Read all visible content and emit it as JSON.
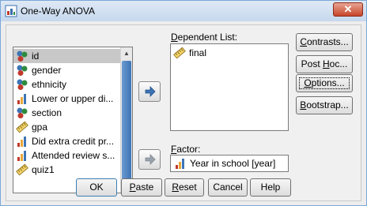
{
  "window": {
    "title": "One-Way ANOVA",
    "close_label": "✕"
  },
  "variables": [
    {
      "label": "id",
      "icon": "nominal-icon",
      "selected": true
    },
    {
      "label": "gender",
      "icon": "nominal-icon"
    },
    {
      "label": "ethnicity",
      "icon": "nominal-icon"
    },
    {
      "label": "Lower or upper di...",
      "icon": "ordinal-icon"
    },
    {
      "label": "section",
      "icon": "nominal-icon"
    },
    {
      "label": "gpa",
      "icon": "scale-icon"
    },
    {
      "label": "Did extra credit pr...",
      "icon": "ordinal-icon"
    },
    {
      "label": "Attended review s...",
      "icon": "ordinal-icon"
    },
    {
      "label": "quiz1",
      "icon": "scale-icon"
    }
  ],
  "dependent": {
    "label_prefix": "",
    "label_u": "D",
    "label_rest": "ependent List:",
    "items": [
      {
        "label": "final",
        "icon": "scale-icon"
      }
    ]
  },
  "factor": {
    "label_u": "F",
    "label_rest": "actor:",
    "value": "Year in school [year]",
    "icon": "ordinal-icon"
  },
  "side_buttons": [
    {
      "name": "contrasts-button",
      "u": "C",
      "rest": "ontrasts..."
    },
    {
      "name": "post-hoc-button",
      "pre": "Post ",
      "u": "H",
      "rest": "oc..."
    },
    {
      "name": "options-button",
      "u": "O",
      "rest": "ptions..."
    },
    {
      "name": "bootstrap-button",
      "u": "B",
      "rest": "ootstrap..."
    }
  ],
  "bottom_buttons": [
    {
      "name": "ok-button",
      "text": "OK"
    },
    {
      "name": "paste-button",
      "u": "P",
      "rest": "aste"
    },
    {
      "name": "reset-button",
      "u": "R",
      "rest": "eset"
    },
    {
      "name": "cancel-button",
      "text": "Cancel"
    },
    {
      "name": "help-button",
      "text": "Help"
    }
  ],
  "colors": {
    "accent": "#3d74b6",
    "title_bg": "#c6d8ee",
    "close": "#c7452a"
  }
}
